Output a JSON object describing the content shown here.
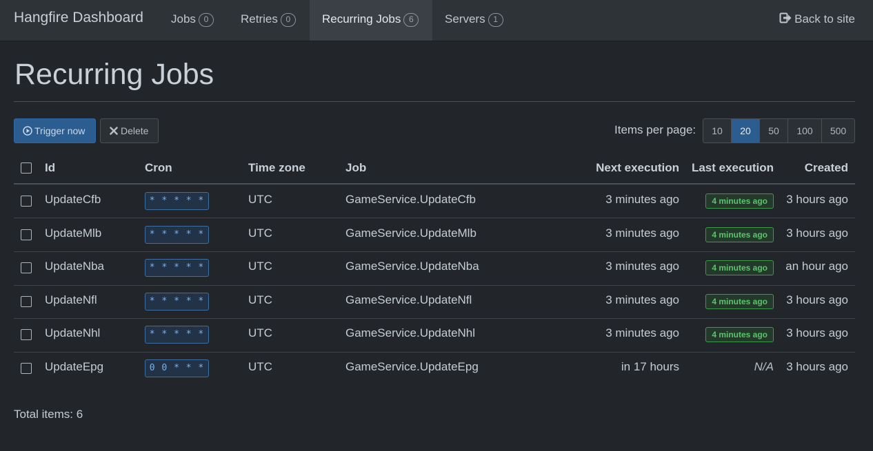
{
  "nav": {
    "brand": "Hangfire Dashboard",
    "items": [
      {
        "label": "Jobs",
        "count": "0"
      },
      {
        "label": "Retries",
        "count": "0"
      },
      {
        "label": "Recurring Jobs",
        "count": "6"
      },
      {
        "label": "Servers",
        "count": "1"
      }
    ],
    "back_label": "Back to site"
  },
  "page": {
    "title": "Recurring Jobs",
    "trigger_label": "Trigger now",
    "delete_label": "Delete",
    "items_per_page_label": "Items per page:",
    "page_sizes": [
      "10",
      "20",
      "50",
      "100",
      "500"
    ],
    "selected_page_size": "20",
    "total_label": "Total items: 6"
  },
  "table": {
    "headers": {
      "id": "Id",
      "cron": "Cron",
      "timezone": "Time zone",
      "job": "Job",
      "next": "Next execution",
      "last": "Last execution",
      "created": "Created"
    },
    "rows": [
      {
        "id": "UpdateCfb",
        "cron": "* * * * *",
        "timezone": "UTC",
        "job": "GameService.UpdateCfb",
        "next": "3 minutes ago",
        "last": "4 minutes ago",
        "created": "3 hours ago"
      },
      {
        "id": "UpdateMlb",
        "cron": "* * * * *",
        "timezone": "UTC",
        "job": "GameService.UpdateMlb",
        "next": "3 minutes ago",
        "last": "4 minutes ago",
        "created": "3 hours ago"
      },
      {
        "id": "UpdateNba",
        "cron": "* * * * *",
        "timezone": "UTC",
        "job": "GameService.UpdateNba",
        "next": "3 minutes ago",
        "last": "4 minutes ago",
        "created": "an hour ago"
      },
      {
        "id": "UpdateNfl",
        "cron": "* * * * *",
        "timezone": "UTC",
        "job": "GameService.UpdateNfl",
        "next": "3 minutes ago",
        "last": "4 minutes ago",
        "created": "3 hours ago"
      },
      {
        "id": "UpdateNhl",
        "cron": "* * * * *",
        "timezone": "UTC",
        "job": "GameService.UpdateNhl",
        "next": "3 minutes ago",
        "last": "4 minutes ago",
        "created": "3 hours ago"
      },
      {
        "id": "UpdateEpg",
        "cron": "0 0 * * *",
        "timezone": "UTC",
        "job": "GameService.UpdateEpg",
        "next": "in 17 hours",
        "last": "N/A",
        "created": "3 hours ago"
      }
    ]
  },
  "colors": {
    "background": "#22262b",
    "navbar": "#2e3338",
    "primary": "#2b5d91",
    "success": "#5cc46c",
    "cron_text": "#7fb2e6"
  }
}
